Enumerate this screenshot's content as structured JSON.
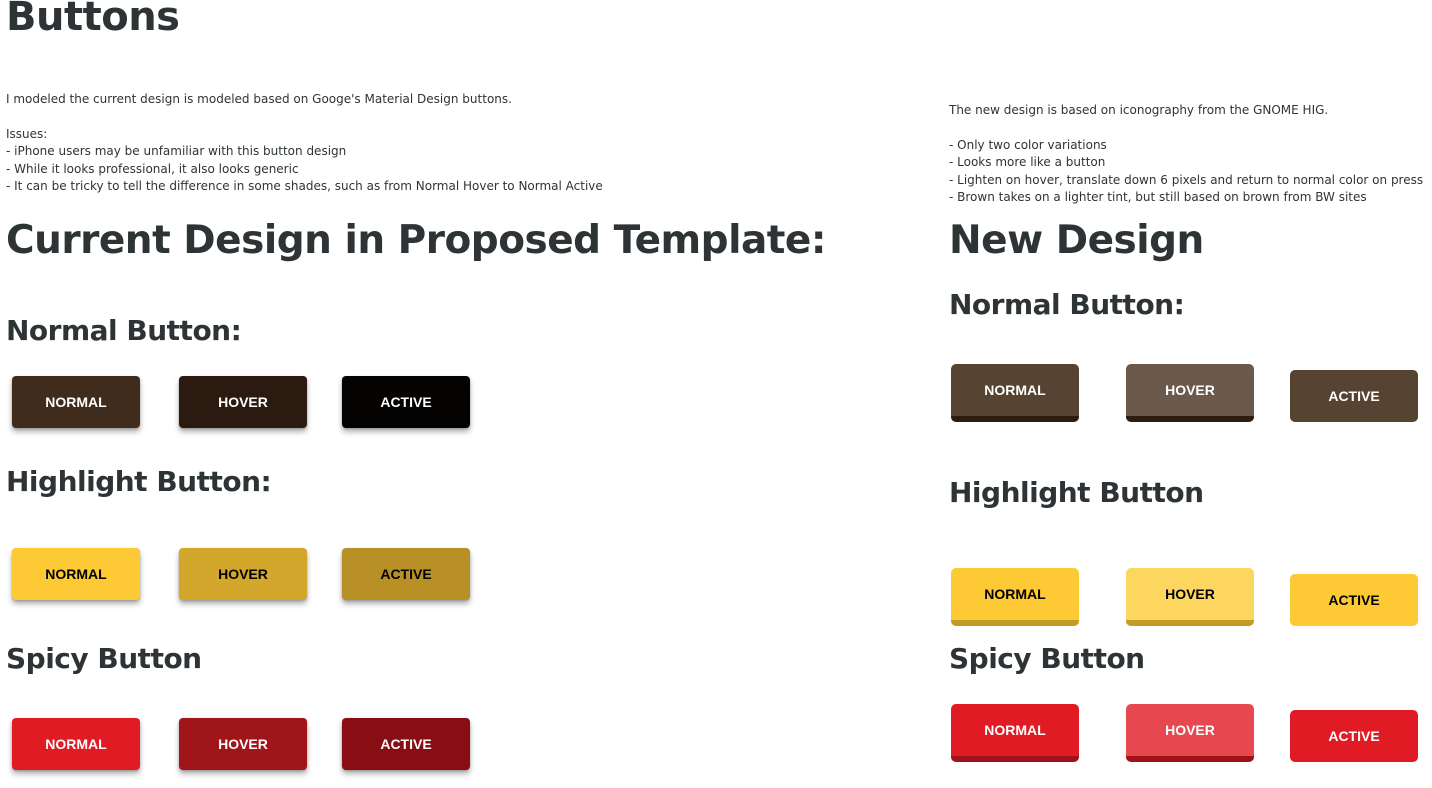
{
  "page_title": "Buttons",
  "left": {
    "intro": "I modeled the current design is modeled based on Googe's Material Design buttons.",
    "issues_heading": "Issues:",
    "issues": [
      "- iPhone users may be unfamiliar with this button design",
      "- While it looks professional, it also looks generic",
      "- It can be tricky to tell the difference in some shades, such as from Normal Hover to Normal Active"
    ],
    "heading": "Current Design in Proposed Template:",
    "sections": [
      {
        "title": "Normal Button:",
        "buttons": [
          {
            "label": "NORMAL",
            "bg": "#3f2c1d",
            "fg": "#ffffff"
          },
          {
            "label": "HOVER",
            "bg": "#2a1a10",
            "fg": "#ffffff"
          },
          {
            "label": "ACTIVE",
            "bg": "#050302",
            "fg": "#ffffff"
          }
        ]
      },
      {
        "title": "Highlight Button:",
        "buttons": [
          {
            "label": "NORMAL",
            "bg": "#fdc934",
            "fg": "#000000"
          },
          {
            "label": "HOVER",
            "bg": "#d3a72b",
            "fg": "#000000"
          },
          {
            "label": "ACTIVE",
            "bg": "#b89025",
            "fg": "#000000"
          }
        ]
      },
      {
        "title": "Spicy Button",
        "buttons": [
          {
            "label": "NORMAL",
            "bg": "#e11b24",
            "fg": "#ffffff"
          },
          {
            "label": "HOVER",
            "bg": "#9f1519",
            "fg": "#ffffff"
          },
          {
            "label": "ACTIVE",
            "bg": "#880e14",
            "fg": "#ffffff"
          }
        ]
      }
    ]
  },
  "right": {
    "intro": "The new design is based on iconography from the GNOME HIG.",
    "points": [
      "- Only two color variations",
      "- Looks more like a button",
      "- Lighten on hover, translate down 6 pixels and return to normal color on press",
      "- Brown takes on a lighter tint, but still based on brown from BW sites"
    ],
    "heading": "New Design",
    "sections": [
      {
        "title": "Normal Button:",
        "buttons": [
          {
            "label": "NORMAL",
            "bg": "#574332",
            "border": "#2c1d12",
            "fg": "#ffffff"
          },
          {
            "label": "HOVER",
            "bg": "#6b594b",
            "border": "#2c1d12",
            "fg": "#ffffff"
          },
          {
            "label": "ACTIVE",
            "bg": "#574332",
            "fg": "#ffffff"
          }
        ]
      },
      {
        "title": "Highlight Button",
        "buttons": [
          {
            "label": "NORMAL",
            "bg": "#fdc934",
            "border": "#c29a26",
            "fg": "#000000"
          },
          {
            "label": "HOVER",
            "bg": "#fdd65f",
            "border": "#c29a26",
            "fg": "#000000"
          },
          {
            "label": "ACTIVE",
            "bg": "#fdc934",
            "fg": "#000000"
          }
        ]
      },
      {
        "title": "Spicy Button",
        "buttons": [
          {
            "label": "NORMAL",
            "bg": "#e11b24",
            "border": "#a01219",
            "fg": "#ffffff"
          },
          {
            "label": "HOVER",
            "bg": "#e7474e",
            "border": "#a01219",
            "fg": "#ffffff"
          },
          {
            "label": "ACTIVE",
            "bg": "#e11b24",
            "fg": "#ffffff"
          }
        ]
      }
    ]
  }
}
